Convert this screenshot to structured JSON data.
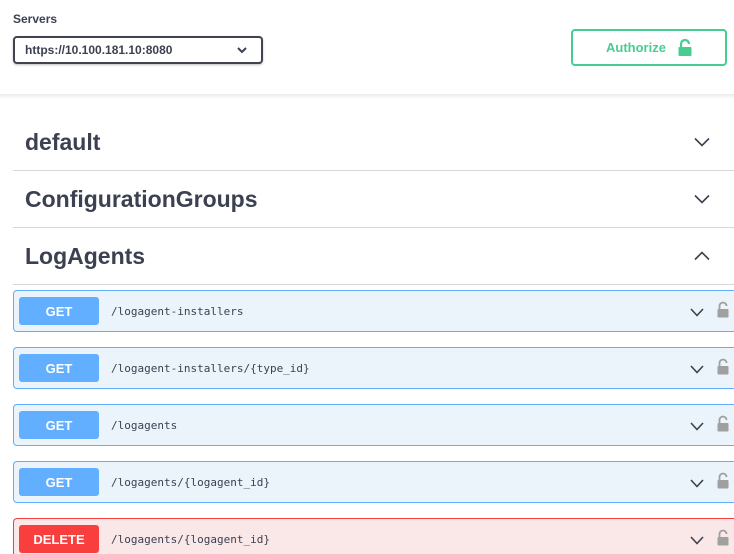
{
  "servers": {
    "label": "Servers",
    "selected": "https://10.100.181.10:8080"
  },
  "authorize": {
    "label": "Authorize"
  },
  "tags": [
    {
      "name": "default",
      "expanded": false
    },
    {
      "name": "ConfigurationGroups",
      "expanded": false
    },
    {
      "name": "LogAgents",
      "expanded": true
    }
  ],
  "operations": [
    {
      "method": "GET",
      "path": "/logagent-installers"
    },
    {
      "method": "GET",
      "path": "/logagent-installers/{type_id}"
    },
    {
      "method": "GET",
      "path": "/logagents"
    },
    {
      "method": "GET",
      "path": "/logagents/{logagent_id}"
    },
    {
      "method": "DELETE",
      "path": "/logagents/{logagent_id}"
    }
  ],
  "colors": {
    "get": "#61affe",
    "delete": "#f93e3e",
    "authorize": "#49cc90",
    "text": "#3b4151"
  }
}
